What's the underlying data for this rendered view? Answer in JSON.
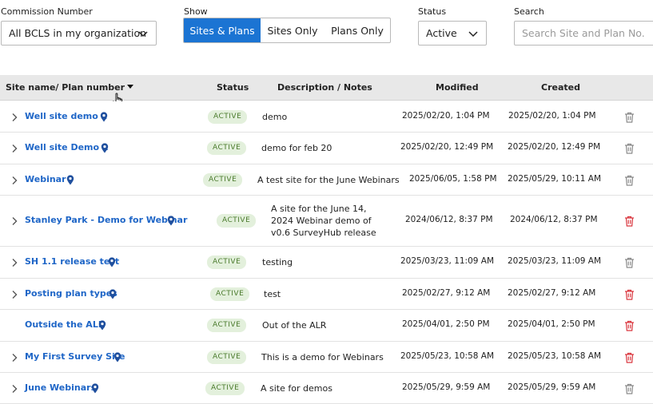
{
  "filters": {
    "commission_label": "Commission Number",
    "commission_value": "All BCLS in my organization",
    "show_label": "Show",
    "show_options": [
      "Sites & Plans",
      "Sites Only",
      "Plans Only"
    ],
    "status_label": "Status",
    "status_value": "Active",
    "search_label": "Search",
    "search_placeholder": "Search Site and Plan No."
  },
  "table": {
    "headers": {
      "site": "Site name/ Plan number",
      "status": "Status",
      "description": "Description / Notes",
      "modified": "Modified",
      "created": "Created"
    },
    "rows": [
      {
        "name": "Well site demo 2",
        "status": "ACTIVE",
        "description": "demo",
        "modified": "2025/02/20, 1:04 PM",
        "created": "2025/02/20, 1:04 PM",
        "delete_color": "#8a8a8a",
        "expandable": true
      },
      {
        "name": "Well site Demo 1",
        "status": "ACTIVE",
        "description": "demo for feb 20",
        "modified": "2025/02/20, 12:49 PM",
        "created": "2025/02/20, 12:49 PM",
        "delete_color": "#8a8a8a",
        "expandable": true
      },
      {
        "name": "Webinar",
        "status": "ACTIVE",
        "description": "A test site for the June Webinars",
        "modified": "2025/06/05, 1:58 PM",
        "created": "2025/05/29, 10:11 AM",
        "delete_color": "#8a8a8a",
        "expandable": true
      },
      {
        "name": "Stanley Park - Demo for Webinar",
        "status": "ACTIVE",
        "description": "A site for the June 14, 2024 Webinar demo of v0.6 SurveyHub release",
        "modified": "2024/06/12, 8:37 PM",
        "created": "2024/06/12, 8:37 PM",
        "delete_color": "#d9363e",
        "expandable": true
      },
      {
        "name": "SH 1.1 release test",
        "status": "ACTIVE",
        "description": "testing",
        "modified": "2025/03/23, 11:09 AM",
        "created": "2025/03/23, 11:09 AM",
        "delete_color": "#8a8a8a",
        "expandable": true
      },
      {
        "name": "Posting plan types",
        "status": "ACTIVE",
        "description": "test",
        "modified": "2025/02/27, 9:12 AM",
        "created": "2025/02/27, 9:12 AM",
        "delete_color": "#d9363e",
        "expandable": true
      },
      {
        "name": "Outside the ALR",
        "status": "ACTIVE",
        "description": "Out of the ALR",
        "modified": "2025/04/01, 2:50 PM",
        "created": "2025/04/01, 2:50 PM",
        "delete_color": "#d9363e",
        "expandable": false
      },
      {
        "name": "My First Survey Site",
        "status": "ACTIVE",
        "description": "This is a demo for Webinars",
        "modified": "2025/05/23, 10:58 AM",
        "created": "2025/05/23, 10:58 AM",
        "delete_color": "#d9363e",
        "expandable": true
      },
      {
        "name": "June Webinars",
        "status": "ACTIVE",
        "description": "A site for demos",
        "modified": "2025/05/29, 9:59 AM",
        "created": "2025/05/29, 9:59 AM",
        "delete_color": "#8a8a8a",
        "expandable": true
      }
    ]
  },
  "colors": {
    "accent": "#1b74d3",
    "link": "#1f66c7",
    "badge_bg": "#e3f0dc",
    "badge_text": "#4a7a2c",
    "header_bg": "#e8e8e8",
    "pin": "#1f4f9e"
  },
  "icons": {
    "expander": "chevron-right-icon",
    "location": "map-pin-icon",
    "delete": "trash-icon",
    "dropdown": "chevron-down-icon",
    "cursor": "hand-pointer-icon"
  }
}
